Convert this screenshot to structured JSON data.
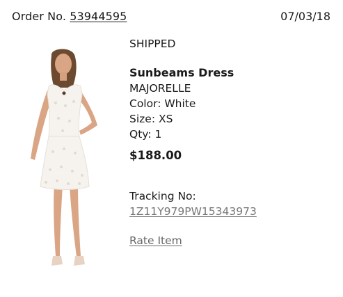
{
  "order": {
    "label": "Order No.",
    "number": "53944595",
    "date": "07/03/18"
  },
  "item": {
    "status": "SHIPPED",
    "name": "Sunbeams Dress",
    "brand": "MAJORELLE",
    "color": "Color: White",
    "size": "Size: XS",
    "qty": "Qty: 1",
    "price": "$188.00",
    "tracking_label": "Tracking No:",
    "tracking_number": "1Z11Y979PW15343973",
    "rate_label": "Rate Item"
  },
  "colors": {
    "text": "#1a1a1a",
    "link": "#777777",
    "dress": "#f6f3ee",
    "skin": "#d9a584",
    "hair": "#6b4a2f"
  }
}
